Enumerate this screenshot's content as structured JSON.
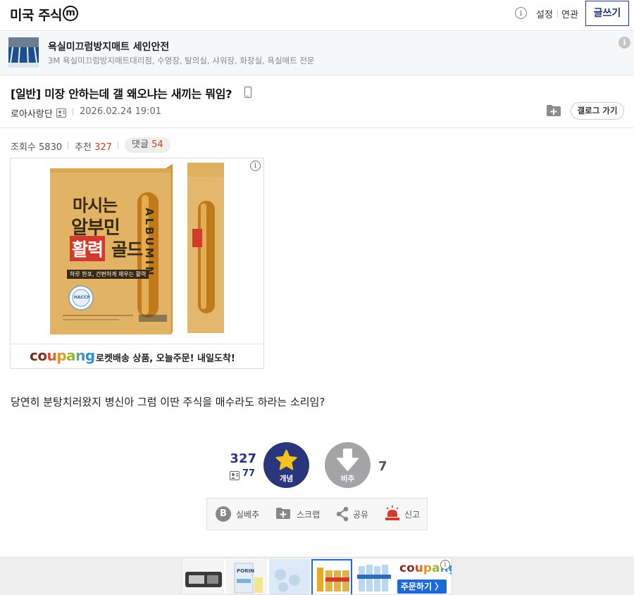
{
  "header": {
    "gallery_title": "미국 주식",
    "minor_badge": "m",
    "info_glyph": "i",
    "settings": "설정",
    "related": "연관",
    "write_button": "글쓰기"
  },
  "promo": {
    "title": "욕실미끄럼방지매트 세인안전",
    "description": "3M 욕실미끄럼방지매트대리점, 수영장, 탈의실, 샤워장, 화장실, 욕실매트 전문",
    "info_glyph": "i"
  },
  "post": {
    "title": "[일반] 미장 안하는데 갤 왜오냐는 새끼는 뭐임?",
    "author": "로아사랑단",
    "date": "2026.02.24 19:01",
    "gallery_go_button": "갤로그 가기",
    "body": "당연히 분탕치러왔지 병신아 그럼 이딴 주식을 매수라도 하라는 소리임?"
  },
  "stats": {
    "views_label": "조회수",
    "views": "5830",
    "recommend_label": "추천",
    "recommend": "327",
    "comments_label": "댓글",
    "comments": "54"
  },
  "ad": {
    "product_line1": "마시는",
    "product_line2": "알부민",
    "product_line3_highlight": "활력",
    "product_line3_rest": "골드",
    "product_vertical": "ALBUMIN",
    "product_sub": "하루 한포, 간편하게 채우는 활력",
    "haccp": "HACCP",
    "coupang_logo": "coupang",
    "tagline": "로켓배송 상품, 오늘주문! 내일도착!",
    "info_glyph": "i"
  },
  "recommend": {
    "count": "327",
    "fix_count": "77",
    "recommend_label": "개념",
    "downvote_label": "비추",
    "downvote_count": "7"
  },
  "actions": {
    "real_best": "실베추",
    "scrap": "스크랩",
    "share": "공유",
    "report": "신고",
    "best_glyph": "B"
  },
  "bottom_ad": {
    "coupang_logo": "coupang",
    "order_button": "주문하기 〉",
    "info_glyph": "i",
    "brand_text": "PORIN"
  },
  "colors": {
    "primary": "#29367c",
    "highlight_red": "#c8412b",
    "downvote_gray": "#a4a4a6",
    "coupang_blue": "#1d6ad6"
  },
  "icons": [
    "minor-gallery-badge",
    "info-icon",
    "mobile-icon",
    "fixed-user-icon",
    "add-folder-icon",
    "star-icon",
    "down-arrow-icon",
    "best-icon",
    "scrap-icon",
    "share-icon",
    "siren-icon"
  ]
}
